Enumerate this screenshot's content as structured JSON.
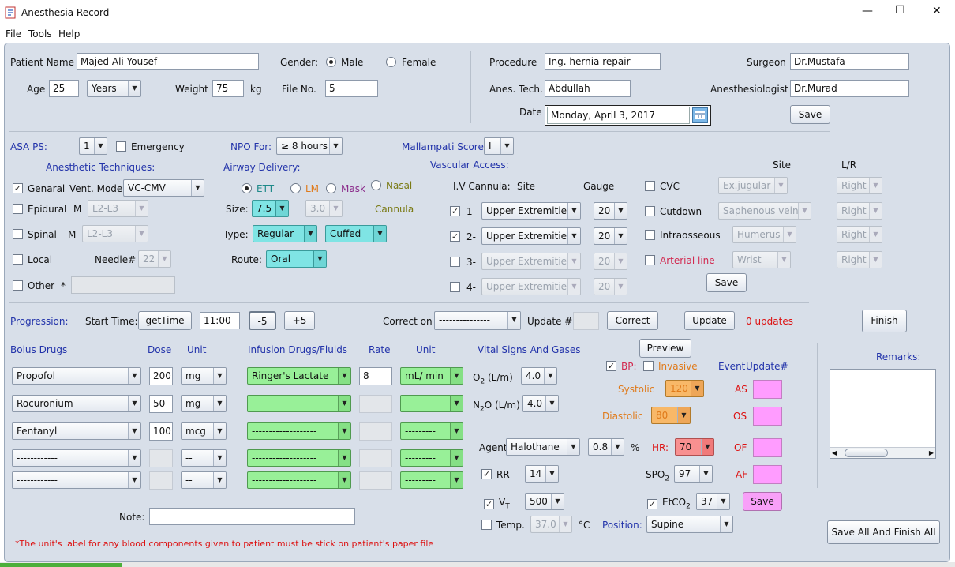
{
  "window": {
    "title": "Anesthesia Record",
    "minimize": "—",
    "maximize": "☐",
    "close": "✕"
  },
  "menu": [
    "File",
    "Tools",
    "Help"
  ],
  "patient": {
    "name_label": "Patient Name",
    "name": "Majed Ali Yousef",
    "gender_label": "Gender:",
    "male": "Male",
    "female": "Female",
    "age_label": "Age",
    "age": "25",
    "age_unit": "Years",
    "weight_label": "Weight",
    "weight": "75",
    "kg": "kg",
    "file_label": "File No.",
    "file_no": "5"
  },
  "procedure": {
    "procedure_label": "Procedure",
    "procedure": "Ing. hernia repair",
    "surgeon_label": "Surgeon",
    "surgeon": "Dr.Mustafa",
    "anes_tech_label": "Anes. Tech.",
    "anes_tech": "Abdullah",
    "anesthesiologist_label": "Anesthesiologist",
    "anesthesiologist": "Dr.Murad",
    "date_label": "Date",
    "date": "Monday, April 3, 2017",
    "save": "Save"
  },
  "asa": {
    "label": "ASA PS:",
    "value": "1",
    "emergency": "Emergency",
    "npo_label": "NPO For:",
    "npo": "≥ 8 hours",
    "mallampati_label": "Mallampati Score",
    "mallampati": "I"
  },
  "techniques": {
    "title": "Anesthetic Techniques:",
    "general": "Genaral",
    "vent_mode_label": "Vent. Mode",
    "vent_mode": "VC-CMV",
    "epidural": "Epidural",
    "epidural_m": "M",
    "epidural_level": "L2-L3",
    "spinal": "Spinal",
    "spinal_m": "M",
    "spinal_level": "L2-L3",
    "local": "Local",
    "needle_label": "Needle#",
    "needle": "22",
    "other": "Other",
    "other_star": "*"
  },
  "airway": {
    "title": "Airway Delivery:",
    "ett": "ETT",
    "lm": "LM",
    "mask": "Mask",
    "nasal": "Nasal",
    "cannula": "Cannula",
    "size_label": "Size:",
    "size": "7.5",
    "size2": "3.0",
    "type_label": "Type:",
    "type": "Regular",
    "cuff": "Cuffed",
    "route_label": "Route:",
    "route": "Oral"
  },
  "vascular": {
    "title": "Vascular Access:",
    "iv_label": "I.V Cannula:",
    "site_col": "Site",
    "gauge_col": "Gauge",
    "site_hdr": "Site",
    "lr_hdr": "L/R",
    "rows": [
      {
        "n": "1-",
        "site": "Upper Extremities",
        "gauge": "20"
      },
      {
        "n": "2-",
        "site": "Upper Extremities",
        "gauge": "20"
      },
      {
        "n": "3-",
        "site": "Upper Extremities",
        "gauge": "20"
      },
      {
        "n": "4-",
        "site": "Upper Extremities",
        "gauge": "20"
      }
    ],
    "cvc": "CVC",
    "cvc_site": "Ex.jugular",
    "cutdown": "Cutdown",
    "cutdown_site": "Saphenous vein",
    "intraosseous": "Intraosseous",
    "intraosseous_site": "Humerus",
    "arterial": "Arterial line",
    "arterial_site": "Wrist",
    "right": "Right",
    "save": "Save"
  },
  "progression": {
    "label": "Progression:",
    "start_time_label": "Start Time:",
    "get_time": "getTime",
    "time": "11:00",
    "minus5": "-5",
    "plus5": "+5",
    "correct_on_label": "Correct on",
    "correct_on": "---------------",
    "update_label": "Update #",
    "correct": "Correct",
    "update": "Update",
    "updates": "0 updates",
    "finish": "Finish"
  },
  "bolus": {
    "title": "Bolus Drugs",
    "dose_hdr": "Dose",
    "unit_hdr": "Unit",
    "rows": [
      {
        "drug": "Propofol",
        "dose": "200",
        "unit": "mg"
      },
      {
        "drug": "Rocuronium",
        "dose": "50",
        "unit": "mg"
      },
      {
        "drug": "Fentanyl",
        "dose": "100",
        "unit": "mcg"
      },
      {
        "drug": "------------",
        "dose": "",
        "unit": "--"
      },
      {
        "drug": "------------",
        "dose": "",
        "unit": "--"
      }
    ]
  },
  "infusion": {
    "title": "Infusion Drugs/Fluids",
    "rate_hdr": "Rate",
    "unit_hdr": "Unit",
    "rows": [
      {
        "drug": "Ringer's Lactate",
        "rate": "8",
        "unit": "mL/ min"
      },
      {
        "drug": "-------------------",
        "rate": "",
        "unit": "---------"
      },
      {
        "drug": "-------------------",
        "rate": "",
        "unit": "---------"
      },
      {
        "drug": "-------------------",
        "rate": "",
        "unit": "---------"
      },
      {
        "drug": "-------------------",
        "rate": "",
        "unit": "---------"
      }
    ]
  },
  "vitals": {
    "title": "Vital Signs And Gases",
    "preview": "Preview",
    "o2_label": "O",
    "o2_sub": "2",
    "o2_unit": " (L/m)",
    "o2": "4.0",
    "n2o_label": "N",
    "n2o_sub": "2",
    "n2o_unit": "O (L/m)",
    "n2o": "4.0",
    "agent_label": "Agent:",
    "agent": "Halothane",
    "agent_pct": "0.8",
    "pct": "%",
    "rr": "RR",
    "rr_val": "14",
    "vt": "V",
    "vt_sub": "T",
    "vt_val": "500",
    "temp": "Temp.",
    "temp_val": "37.0",
    "temp_unit": "°C",
    "position_label": "Position:",
    "position": "Supine",
    "bp": "BP:",
    "invasive": "Invasive",
    "event_label": "Event",
    "update_label": "Update#",
    "systolic_label": "Systolic",
    "systolic": "120",
    "diastolic_label": "Diastolic",
    "diastolic": "80",
    "hr_label": "HR:",
    "hr": "70",
    "spo2_label": "SPO",
    "spo2_sub": "2",
    "spo2": "97",
    "etco2_label": "EtCO",
    "etco2_sub": "2",
    "etco2": "37",
    "save": "Save",
    "events": [
      "AS",
      "OS",
      "OF",
      "AF"
    ]
  },
  "remarks": {
    "label": "Remarks:"
  },
  "note": {
    "label": "Note:",
    "value": ""
  },
  "footer": {
    "warning": "*The unit's label for any  blood components given to patient must be stick on patient's paper file",
    "save_all": "Save All And Finish All"
  }
}
